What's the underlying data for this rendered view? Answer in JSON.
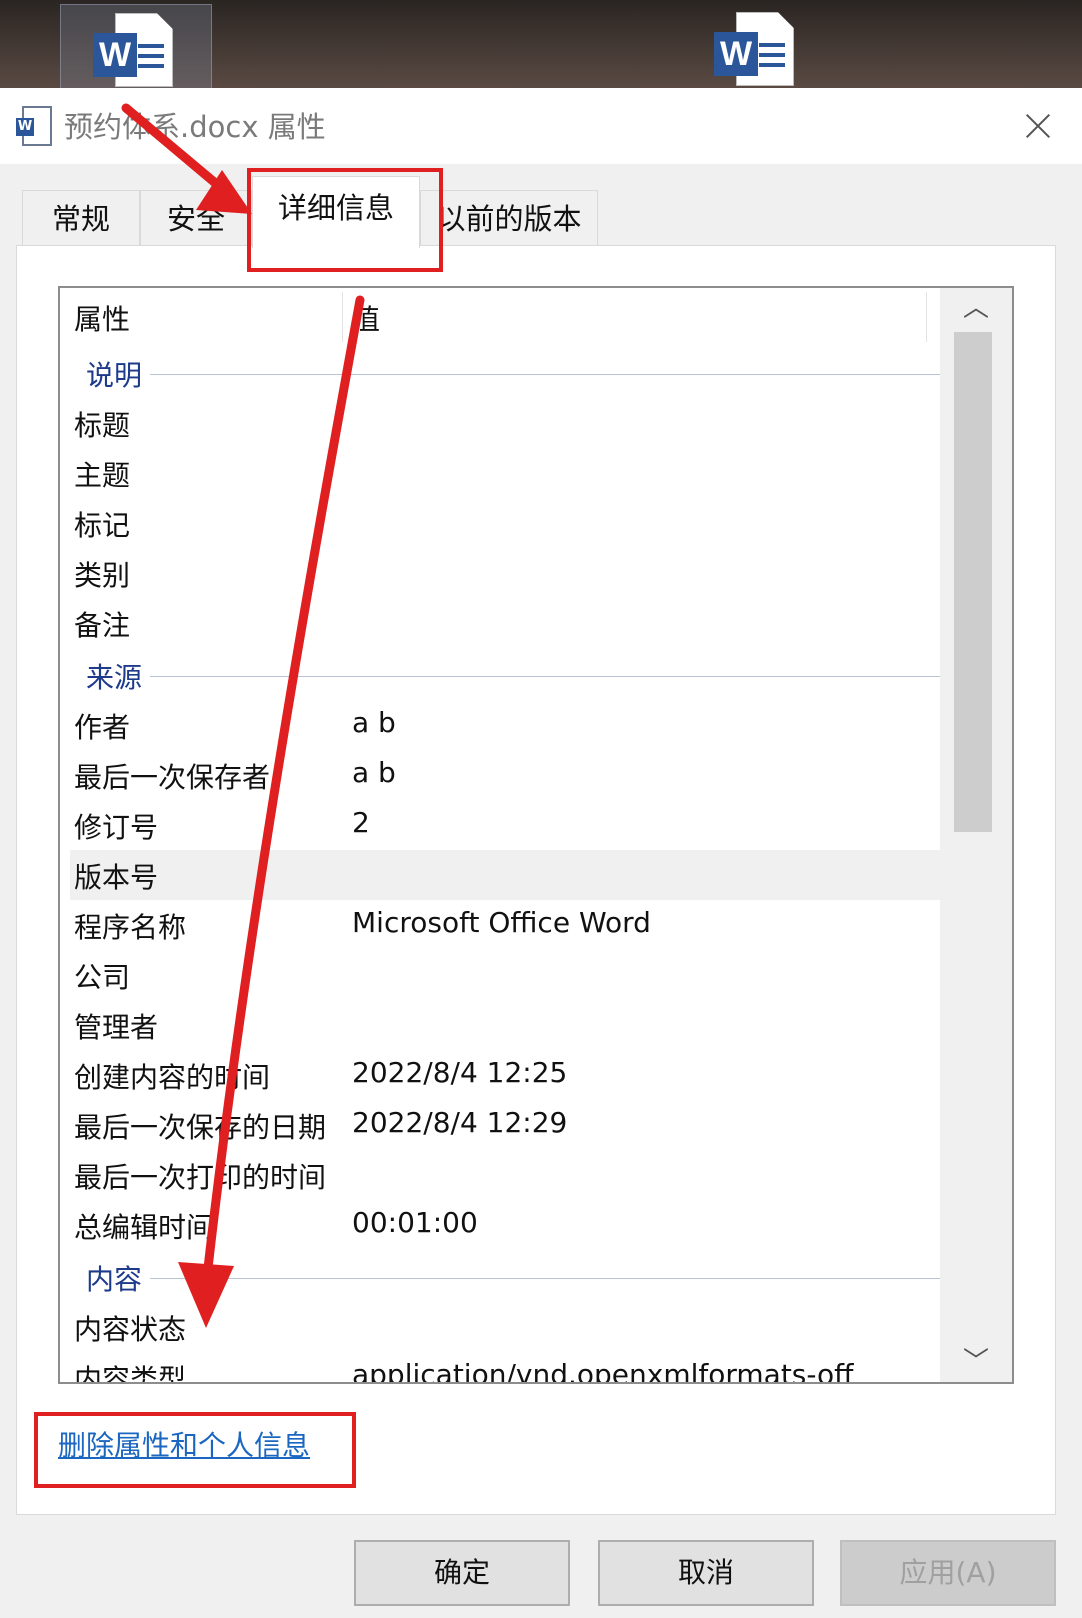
{
  "window": {
    "title": "预约体系.docx 属性",
    "close_label": "×"
  },
  "tabs": [
    {
      "label": "常规"
    },
    {
      "label": "安全"
    },
    {
      "label": "详细信息",
      "active": true
    },
    {
      "label": "以前的版本"
    }
  ],
  "list": {
    "columns": {
      "name": "属性",
      "value": "值"
    },
    "groups": {
      "description": "说明",
      "origin": "来源",
      "content": "内容"
    },
    "description_rows": [
      {
        "name": "标题",
        "value": ""
      },
      {
        "name": "主题",
        "value": ""
      },
      {
        "name": "标记",
        "value": ""
      },
      {
        "name": "类别",
        "value": ""
      },
      {
        "name": "备注",
        "value": ""
      }
    ],
    "origin_rows": [
      {
        "name": "作者",
        "value": "a b"
      },
      {
        "name": "最后一次保存者",
        "value": "a b"
      },
      {
        "name": "修订号",
        "value": "2"
      },
      {
        "name": "版本号",
        "value": "",
        "highlighted": true
      },
      {
        "name": "程序名称",
        "value": "Microsoft Office Word"
      },
      {
        "name": "公司",
        "value": ""
      },
      {
        "name": "管理者",
        "value": ""
      },
      {
        "name": "创建内容的时间",
        "value": "2022/8/4 12:25"
      },
      {
        "name": "最后一次保存的日期",
        "value": "2022/8/4 12:29"
      },
      {
        "name": "最后一次打印的时间",
        "value": ""
      },
      {
        "name": "总编辑时间",
        "value": "00:01:00"
      }
    ],
    "content_rows": [
      {
        "name": "内容状态",
        "value": ""
      },
      {
        "name": "内容类型",
        "value": "application/vnd.openxmlformats-off"
      }
    ]
  },
  "remove_link": "删除属性和个人信息",
  "buttons": {
    "ok": "确定",
    "cancel": "取消",
    "apply": "应用(A)"
  },
  "annotation_color": "#e02020",
  "icons": [
    "word-file-icon",
    "close-icon",
    "scroll-up-icon",
    "scroll-down-icon"
  ]
}
